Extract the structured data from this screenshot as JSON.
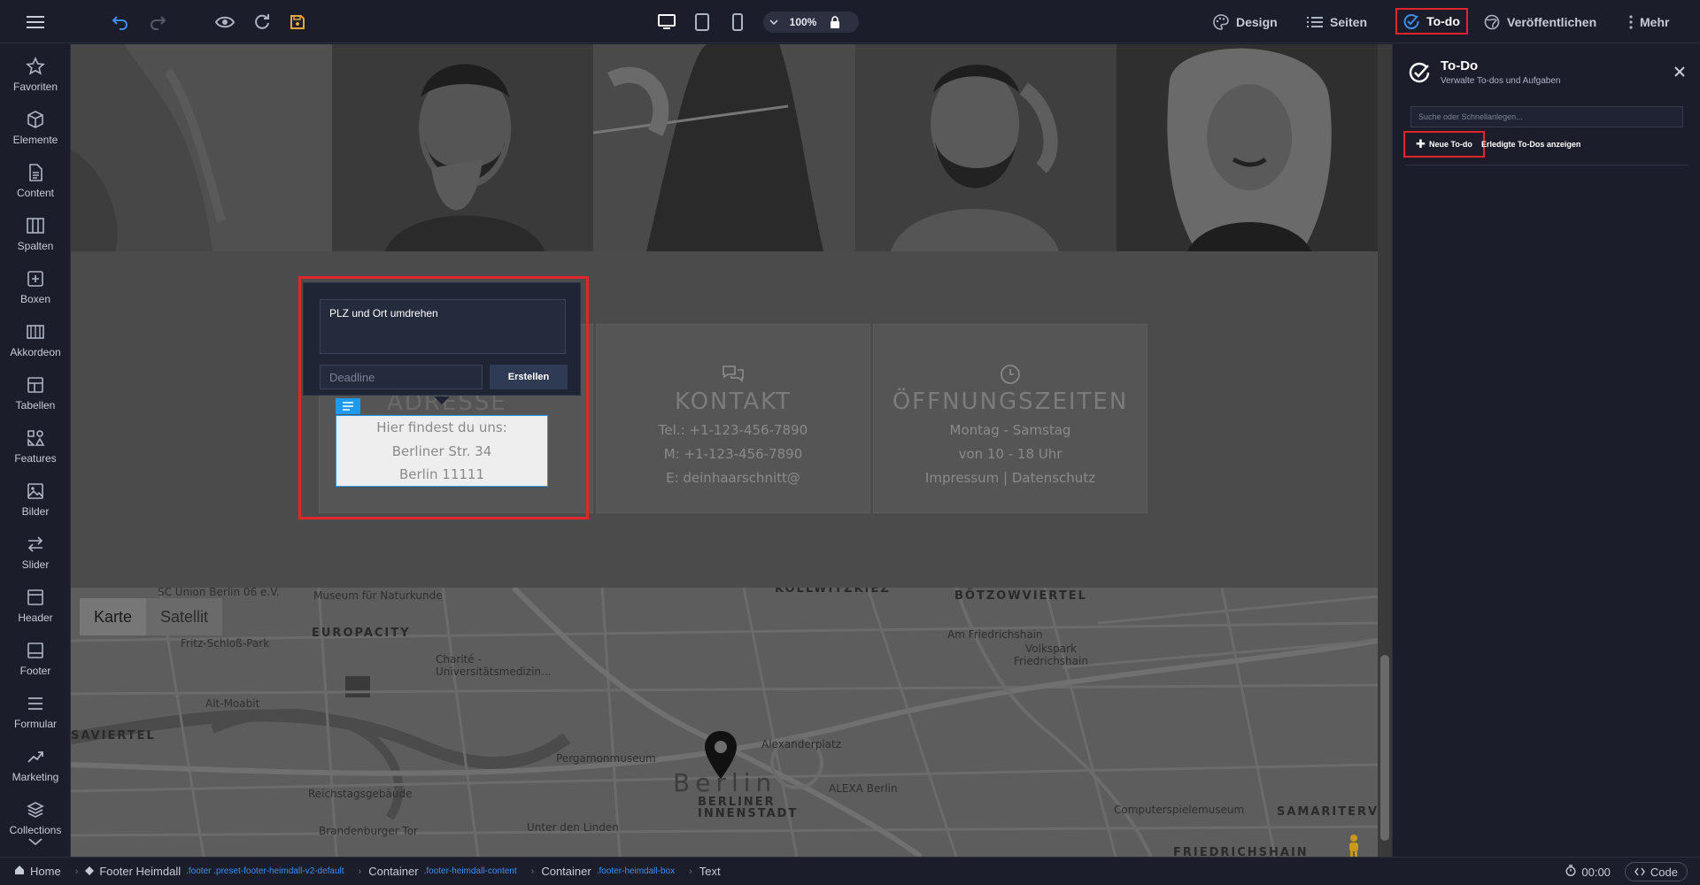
{
  "toolbar": {
    "zoom_value": "100%",
    "design_label": "Design",
    "pages_label": "Seiten",
    "todo_label": "To-do",
    "publish_label": "Veröffentlichen",
    "more_label": "Mehr"
  },
  "sidebar": {
    "items": [
      {
        "label": "Favoriten",
        "icon": "star-icon"
      },
      {
        "label": "Elemente",
        "icon": "cube-icon"
      },
      {
        "label": "Content",
        "icon": "document-icon"
      },
      {
        "label": "Spalten",
        "icon": "columns-icon"
      },
      {
        "label": "Boxen",
        "icon": "box-plus-icon"
      },
      {
        "label": "Akkordeon",
        "icon": "accordion-icon"
      },
      {
        "label": "Tabellen",
        "icon": "table-icon"
      },
      {
        "label": "Features",
        "icon": "features-icon"
      },
      {
        "label": "Bilder",
        "icon": "image-icon"
      },
      {
        "label": "Slider",
        "icon": "slider-icon"
      },
      {
        "label": "Header",
        "icon": "header-icon"
      },
      {
        "label": "Footer",
        "icon": "footer-icon"
      },
      {
        "label": "Formular",
        "icon": "form-icon"
      },
      {
        "label": "Marketing",
        "icon": "marketing-icon"
      },
      {
        "label": "Collections",
        "icon": "layers-icon"
      }
    ]
  },
  "page": {
    "cards": {
      "adresse": {
        "title": "ADRESSE",
        "lines": [
          "Hier findest du uns:",
          "Berliner Str. 34",
          "Berlin 11111"
        ]
      },
      "kontakt": {
        "title": "KONTAKT",
        "lines": [
          "Tel.: +1-123-456-7890",
          "M: +1-123-456-7890",
          "E: deinhaarschnitt@"
        ]
      },
      "oeffnungszeiten": {
        "title": "ÖFFNUNGSZEITEN",
        "lines": [
          "Montag - Samstag",
          "von 10 - 18 Uhr",
          "Impressum | Datenschutz"
        ]
      }
    },
    "todo_popup": {
      "text": "PLZ und Ort umdrehen",
      "deadline_placeholder": "Deadline",
      "create_label": "Erstellen"
    },
    "map": {
      "type_map": "Karte",
      "type_satellite": "Satellit",
      "labels": [
        "SC Union Berlin 06 e.V.",
        "Museum für Naturkunde",
        "KOLLWITZKIEZ",
        "BÖTZOWVIERTEL",
        "EUROPACITY",
        "Fritz-Schloß-Park",
        "Charité - Universitätsmedizin...",
        "Am Friedrichshain",
        "Volkspark Friedrichshain",
        "Alt-Moabit",
        "SAVIERTEL",
        "Pergamonmuseum",
        "Alexanderplatz",
        "Reichstagsgebäude",
        "ALEXA Berlin",
        "Computerspielemuseum",
        "Brandenburger Tor",
        "Unter den Linden",
        "BERLINER INNENSTADT",
        "SAMARITERV",
        "FRIEDRICHSHAIN",
        "Berlin"
      ]
    }
  },
  "todo_panel": {
    "title": "To-Do",
    "subtitle": "Verwalte To-dos und Aufgaben",
    "search_placeholder": "Suche oder Schnellanlegen...",
    "new_label": "Neue To-do",
    "show_done_label": "Erledigte To-Dos anzeigen"
  },
  "breadcrumb": [
    {
      "label": "Home",
      "sub": ""
    },
    {
      "label": "Footer Heimdall",
      "sub": ".footer .preset-footer-heimdall-v2-default"
    },
    {
      "label": "Container",
      "sub": ".footer-heimdall-content"
    },
    {
      "label": "Container",
      "sub": ".footer-heimdall-box"
    },
    {
      "label": "Text",
      "sub": ""
    }
  ],
  "status": {
    "time": "00:00",
    "code_label": "Code"
  },
  "colors": {
    "highlight": "#e0262b",
    "selection": "#1e9bf0",
    "background": "#1b1e2a"
  }
}
